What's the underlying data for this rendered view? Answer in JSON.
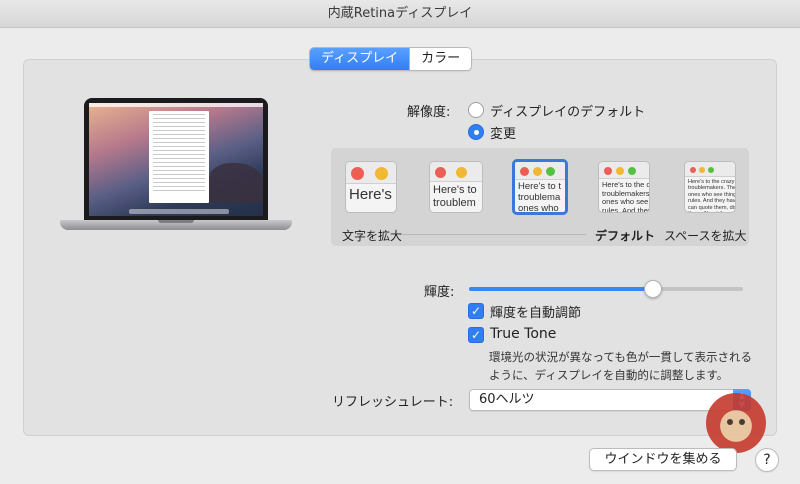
{
  "window": {
    "title": "内蔵Retinaディスプレイ"
  },
  "tabs": [
    {
      "label": "ディスプレイ",
      "active": true
    },
    {
      "label": "カラー",
      "active": false
    }
  ],
  "resolution": {
    "label": "解像度:",
    "options": [
      {
        "label": "ディスプレイのデフォルト",
        "selected": false
      },
      {
        "label": "変更",
        "selected": true
      }
    ],
    "scale_left_label": "文字を拡大",
    "scale_default_label": "デフォルト",
    "scale_right_label": "スペースを拡大",
    "thumbnails": [
      {
        "lines": [
          "Here's"
        ]
      },
      {
        "lines": [
          "Here's to",
          "troublem"
        ]
      },
      {
        "lines": [
          "Here's to t",
          "troublema",
          "ones who"
        ]
      },
      {
        "lines": [
          "Here's to the c",
          "troublemakers.",
          "ones who see t",
          "rules. And they"
        ]
      },
      {
        "lines": [
          "Here's to the crazy one",
          "troublemakers. The r",
          "ones who see things di",
          "rules. And they have n",
          "can quote them, disagre",
          "them. About the only th",
          "Because they change thi"
        ]
      }
    ],
    "selected_index": 2
  },
  "brightness": {
    "label": "輝度:",
    "level_percent": 67,
    "auto_label": "輝度を自動調節",
    "auto_checked": true
  },
  "true_tone": {
    "label": "True Tone",
    "checked": true,
    "description_line1": "環境光の状況が異なっても色が一貫して表示される",
    "description_line2": "ように、ディスプレイを自動的に調整します。"
  },
  "refresh": {
    "label": "リフレッシュレート:",
    "value": "60ヘルツ"
  },
  "buttons": {
    "gather_windows": "ウインドウを集める",
    "help": "?"
  },
  "colors": {
    "accent": "#2f7ef6",
    "traffic_red": "#ec5f57",
    "traffic_yellow": "#f0b833",
    "traffic_green": "#56c043"
  }
}
